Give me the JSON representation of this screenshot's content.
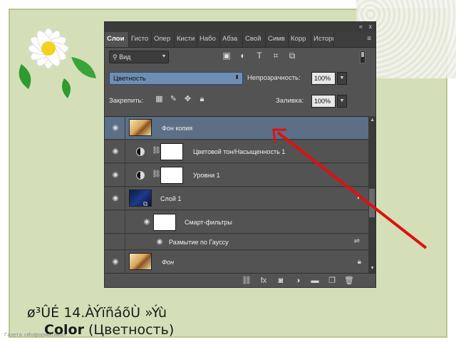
{
  "panel": {
    "tabs": [
      "Слои",
      "Гисто",
      "Опер",
      "Кисти",
      "Набо",
      "Абза",
      "Свой",
      "Симв",
      "Корр",
      "Истори"
    ],
    "tab_menu": "≡",
    "topbar_collapse": "«",
    "topbar_close": "x",
    "kind_filter": "Вид",
    "blend_mode": "Цветность",
    "opacity_label": "Непрозрачность:",
    "opacity_value": "100%",
    "lock_label": "Закрепить:",
    "fill_label": "Заливка:",
    "fill_value": "100%",
    "layers": [
      {
        "name": "Фон копия",
        "selected": true
      },
      {
        "name": "Цветовой тон/Насыщенность 1"
      },
      {
        "name": "Уровни 1"
      },
      {
        "name": "Слой 1"
      },
      {
        "name": "Смарт-фильтры"
      },
      {
        "name": "Размытие по Гауссу"
      },
      {
        "name": "Фон"
      }
    ]
  },
  "caption": {
    "line1": "ø³ÛÉ 14.ÀÝïñáõÙ »Ýù",
    "line2_bold": "Color",
    "line2_rest": "(Цветность)"
  },
  "watermark": "Газета «Информатика»",
  "colors": {
    "panel_bg": "#535353",
    "selected_layer": "#5b6f86",
    "arrow": "#e01010",
    "slide_bg": "#d4dfb8"
  }
}
